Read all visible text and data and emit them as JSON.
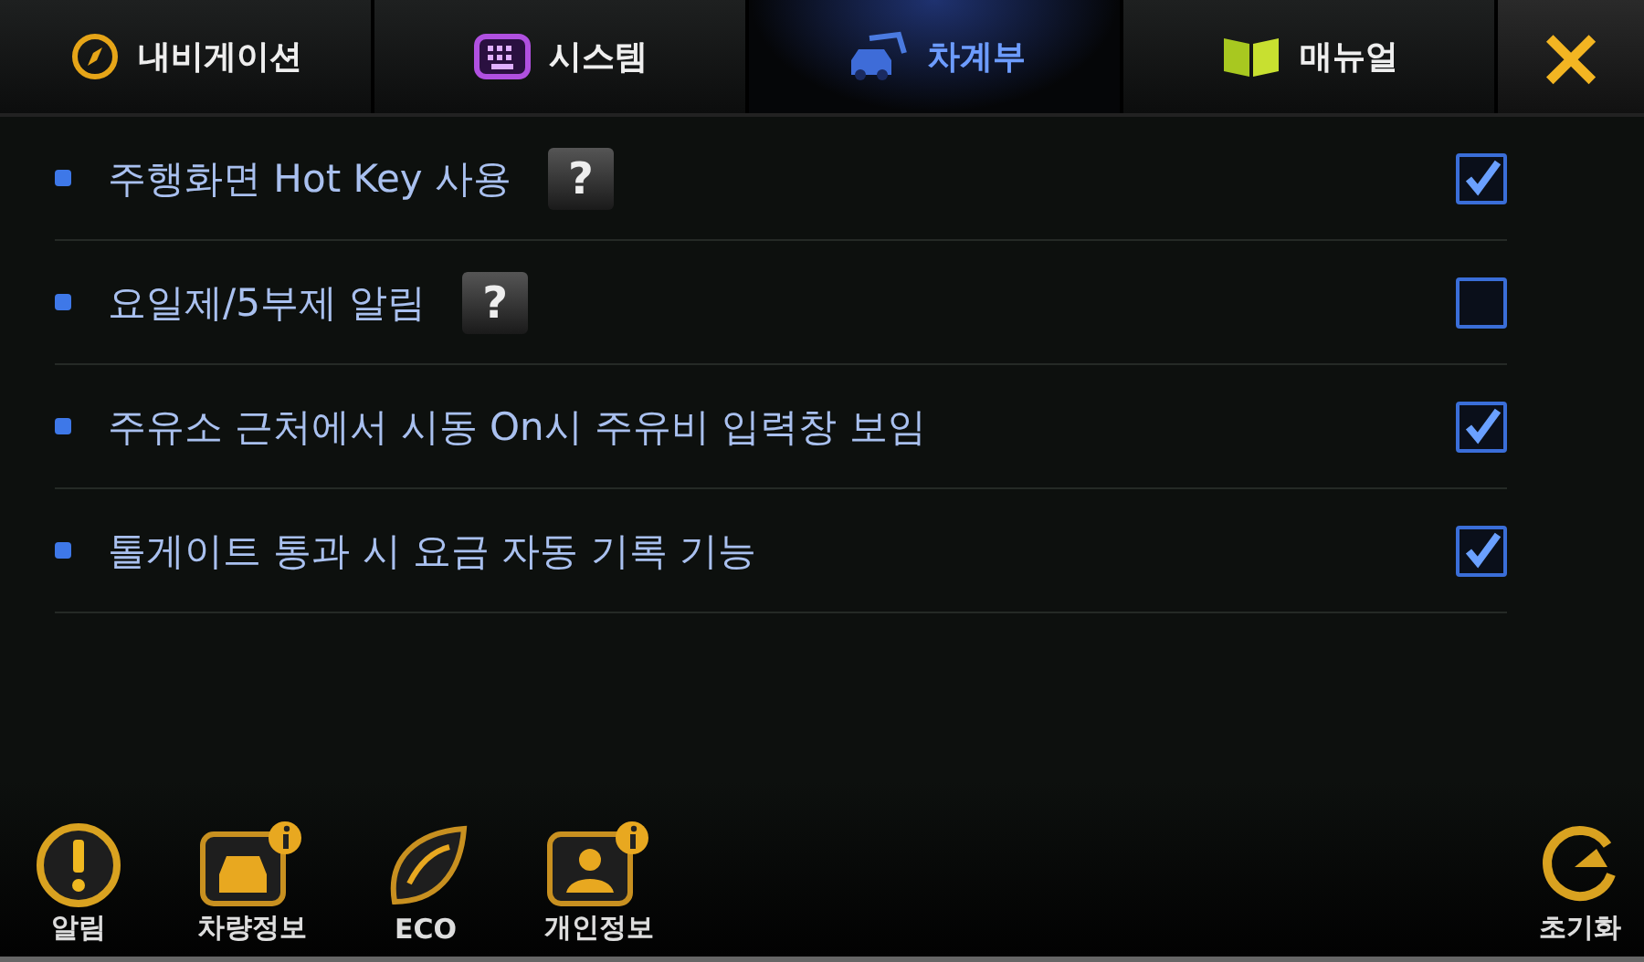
{
  "tabs": [
    {
      "label": "내비게이션",
      "kind": "compass",
      "selected": false
    },
    {
      "label": "시스템",
      "kind": "keypad",
      "selected": false
    },
    {
      "label": "차계부",
      "kind": "car",
      "selected": true
    },
    {
      "label": "매뉴얼",
      "kind": "book",
      "selected": false
    }
  ],
  "close": "×",
  "settings": [
    {
      "label": "주행화면 Hot Key 사용",
      "help": "?",
      "checked": true
    },
    {
      "label": "요일제/5부제 알림",
      "help": "?",
      "checked": false
    },
    {
      "label": "주유소 근처에서 시동 On시 주유비 입력창 보임",
      "checked": true
    },
    {
      "label": "톨게이트 통과 시 요금 자동 기록 기능",
      "checked": true
    }
  ],
  "bottom_buttons": [
    {
      "label": "알림",
      "kind": "alert"
    },
    {
      "label": "차량정보",
      "kind": "car-info"
    },
    {
      "label": "ECO",
      "kind": "leaf"
    },
    {
      "label": "개인정보",
      "kind": "person-info"
    }
  ],
  "reset_button": {
    "label": "초기화"
  }
}
